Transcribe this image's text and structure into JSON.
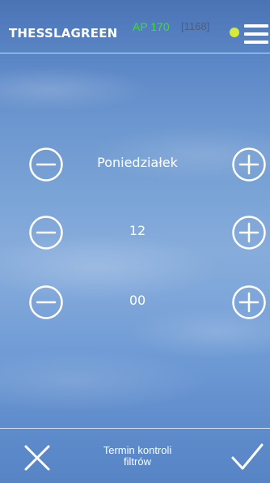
{
  "header": {
    "brand": "THESSLAGREEN",
    "model": "AP 170",
    "serial": "[1168]",
    "status_color": "#d6ea3a"
  },
  "steppers": [
    {
      "value": "Poniedziałek",
      "decrement_icon": "minus-circle-icon",
      "increment_icon": "plus-circle-icon"
    },
    {
      "value": "12",
      "decrement_icon": "minus-circle-icon",
      "increment_icon": "plus-circle-icon"
    },
    {
      "value": "00",
      "decrement_icon": "minus-circle-icon",
      "increment_icon": "plus-circle-icon"
    }
  ],
  "footer": {
    "title_line1": "Termin kontroli",
    "title_line2": "filtrów",
    "cancel_icon": "close-icon",
    "confirm_icon": "checkmark-icon"
  },
  "colors": {
    "accent": "#3ddc3d",
    "text": "#ffffff"
  }
}
